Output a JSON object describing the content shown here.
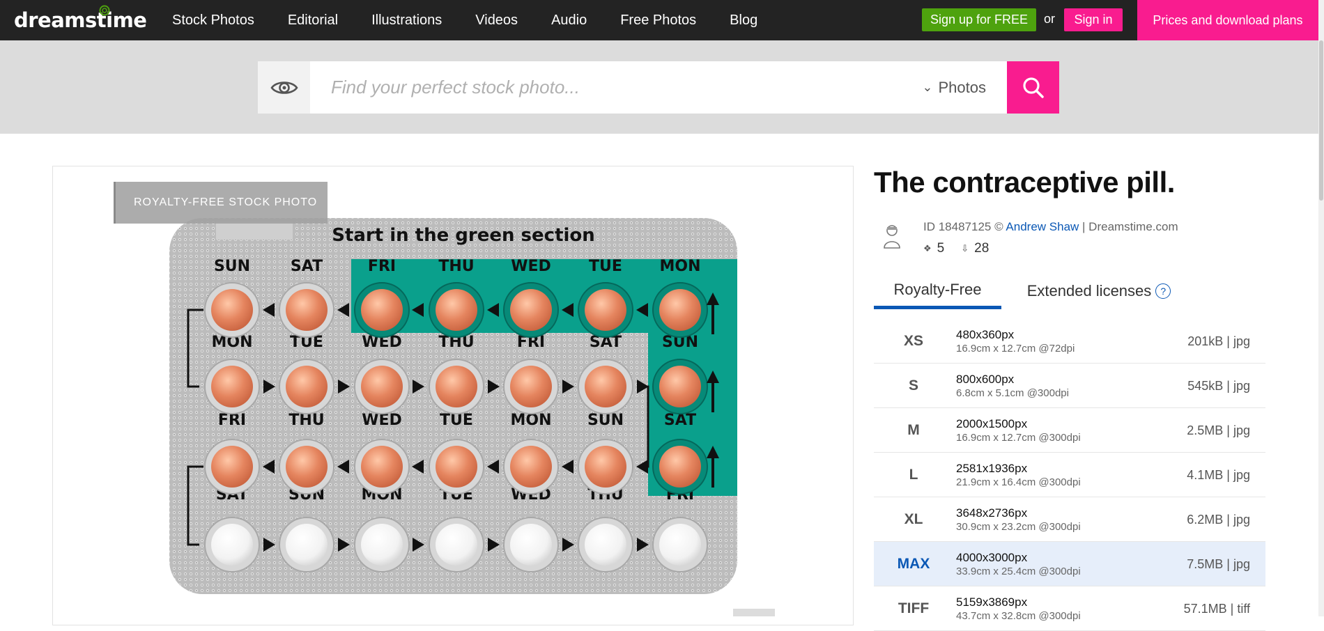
{
  "brand": {
    "logo_text": "dreamstime",
    "accent": "#f91c8f",
    "green": "#4ea20e",
    "link_blue": "#0b58b5"
  },
  "nav": {
    "links": [
      "Stock Photos",
      "Editorial",
      "Illustrations",
      "Videos",
      "Audio",
      "Free Photos",
      "Blog"
    ],
    "signup_label": "Sign up for FREE",
    "or_label": "or",
    "signin_label": "Sign in",
    "prices_label": "Prices and download plans"
  },
  "search": {
    "placeholder": "Find your perfect stock photo...",
    "value": "",
    "type_label": "Photos",
    "visual_search_icon": "eye-icon",
    "submit_icon": "search-icon"
  },
  "image": {
    "badge": "ROYALTY-FREE STOCK PHOTO",
    "pack_heading": "Start in the green section",
    "row1_days": [
      "SUN",
      "SAT",
      "FRI",
      "THU",
      "WED",
      "TUE",
      "MON"
    ],
    "row2_days": [
      "MON",
      "TUE",
      "WED",
      "THU",
      "FRI",
      "SAT",
      "SUN"
    ],
    "row3_days": [
      "FRI",
      "THU",
      "WED",
      "TUE",
      "MON",
      "SUN",
      "SAT"
    ],
    "row4_days": [
      "SAT",
      "SUN",
      "MON",
      "TUE",
      "WED",
      "THU",
      "FRI"
    ],
    "pill_color": "#e5855f",
    "green_section_color": "#0aa08c"
  },
  "details": {
    "title": "The contraceptive pill.",
    "id_label": "ID 18487125 ©",
    "author": "Andrew Shaw",
    "site": "| Dreamstime.com",
    "views": "5",
    "downloads": "28",
    "views_icon": "views-icon",
    "downloads_icon": "download-icon"
  },
  "tabs": {
    "royalty_free": "Royalty-Free",
    "extended": "Extended licenses",
    "help": "?"
  },
  "sizes": [
    {
      "code": "XS",
      "px": "480x360px",
      "cm": "16.9cm x 12.7cm @72dpi",
      "file": "201kB | jpg"
    },
    {
      "code": "S",
      "px": "800x600px",
      "cm": "6.8cm x 5.1cm @300dpi",
      "file": "545kB | jpg"
    },
    {
      "code": "M",
      "px": "2000x1500px",
      "cm": "16.9cm x 12.7cm @300dpi",
      "file": "2.5MB | jpg"
    },
    {
      "code": "L",
      "px": "2581x1936px",
      "cm": "21.9cm x 16.4cm @300dpi",
      "file": "4.1MB | jpg"
    },
    {
      "code": "XL",
      "px": "3648x2736px",
      "cm": "30.9cm x 23.2cm @300dpi",
      "file": "6.2MB | jpg"
    },
    {
      "code": "MAX",
      "px": "4000x3000px",
      "cm": "33.9cm x 25.4cm @300dpi",
      "file": "7.5MB | jpg"
    },
    {
      "code": "TIFF",
      "px": "5159x3869px",
      "cm": "43.7cm x 32.8cm @300dpi",
      "file": "57.1MB | tiff"
    }
  ]
}
